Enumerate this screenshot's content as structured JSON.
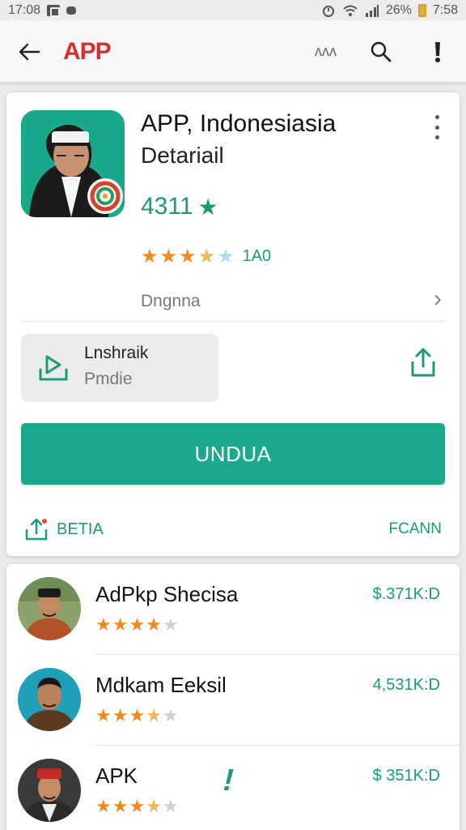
{
  "status_bar": {
    "time": "17:08",
    "battery": "26%",
    "clock_right": "7:58"
  },
  "app_bar": {
    "title": "APP",
    "wave": "ʌʌʌ"
  },
  "app": {
    "name": "APP, Indonesiasia",
    "subtitle": "Detariail",
    "score": "4311",
    "review_count": "1A0",
    "rating_fraction": 0.7,
    "developer": "Dngnna"
  },
  "install_chip": {
    "line1": "Lnshraik",
    "line2": "Pmdie"
  },
  "download_label": "UNDUA",
  "beta_label": "BETIA",
  "scan_label": "FCANN",
  "list": [
    {
      "name": "AdPkp Shecisa",
      "price": "$.371K:D",
      "stars": 4
    },
    {
      "name": "Mdkam Eeksil",
      "price": "4,531K:D",
      "stars": 3.5
    },
    {
      "name": "APK",
      "price": "$ 351K:D",
      "stars": 3.5
    }
  ],
  "accent_color": "#1aa98b",
  "brand_color": "#d32f2f"
}
